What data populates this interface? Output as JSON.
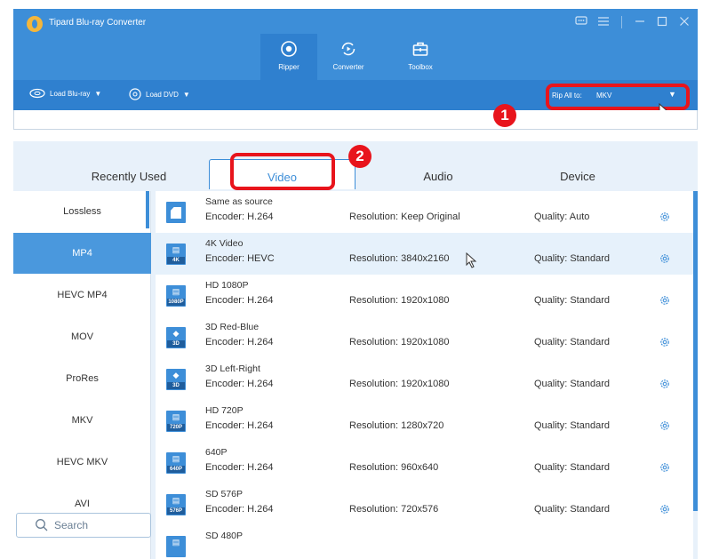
{
  "app": {
    "title": "Tipard Blu-ray Converter",
    "logo_icon": "disc-logo-icon"
  },
  "window_controls": [
    "chat-icon",
    "menu-icon",
    "minimize-icon",
    "maximize-icon",
    "close-icon"
  ],
  "modes": [
    {
      "label": "Ripper",
      "icon": "ripper-icon",
      "active": true
    },
    {
      "label": "Converter",
      "icon": "converter-icon",
      "active": false
    },
    {
      "label": "Toolbox",
      "icon": "toolbox-icon",
      "active": false
    }
  ],
  "toolbar": {
    "load_bluray": "Load Blu-ray",
    "load_dvd": "Load DVD",
    "rip_all_label": "Rip All to:",
    "rip_all_value": "MKV"
  },
  "annotations": {
    "badge1": "1",
    "badge2": "2"
  },
  "tabs": [
    {
      "label": "Recently Used",
      "active": false
    },
    {
      "label": "Video",
      "active": true
    },
    {
      "label": "Audio",
      "active": false
    },
    {
      "label": "Device",
      "active": false
    }
  ],
  "sidebar": {
    "items": [
      "Lossless",
      "MP4",
      "HEVC MP4",
      "MOV",
      "ProRes",
      "MKV",
      "HEVC MKV",
      "AVI"
    ],
    "active_index": 1,
    "search_label": "Search"
  },
  "formats": [
    {
      "name": "Same as source",
      "encoder": "Encoder: H.264",
      "resolution": "Resolution: Keep Original",
      "quality": "Quality: Auto",
      "tag": ""
    },
    {
      "name": "4K Video",
      "encoder": "Encoder: HEVC",
      "resolution": "Resolution: 3840x2160",
      "quality": "Quality: Standard",
      "tag": "4K"
    },
    {
      "name": "HD 1080P",
      "encoder": "Encoder: H.264",
      "resolution": "Resolution: 1920x1080",
      "quality": "Quality: Standard",
      "tag": "1080P"
    },
    {
      "name": "3D Red-Blue",
      "encoder": "Encoder: H.264",
      "resolution": "Resolution: 1920x1080",
      "quality": "Quality: Standard",
      "tag": "3D"
    },
    {
      "name": "3D Left-Right",
      "encoder": "Encoder: H.264",
      "resolution": "Resolution: 1920x1080",
      "quality": "Quality: Standard",
      "tag": "3D"
    },
    {
      "name": "HD 720P",
      "encoder": "Encoder: H.264",
      "resolution": "Resolution: 1280x720",
      "quality": "Quality: Standard",
      "tag": "720P"
    },
    {
      "name": "640P",
      "encoder": "Encoder: H.264",
      "resolution": "Resolution: 960x640",
      "quality": "Quality: Standard",
      "tag": "640P"
    },
    {
      "name": "SD 576P",
      "encoder": "Encoder: H.264",
      "resolution": "Resolution: 720x576",
      "quality": "Quality: Standard",
      "tag": "576P"
    },
    {
      "name": "SD 480P",
      "encoder": "",
      "resolution": "",
      "quality": "",
      "tag": ""
    }
  ],
  "selected_format_index": 1,
  "colors": {
    "accent": "#3d8ed8",
    "toolbar": "#2f80cf",
    "highlight": "#e8141c",
    "selected_row": "#e6f1fb"
  }
}
